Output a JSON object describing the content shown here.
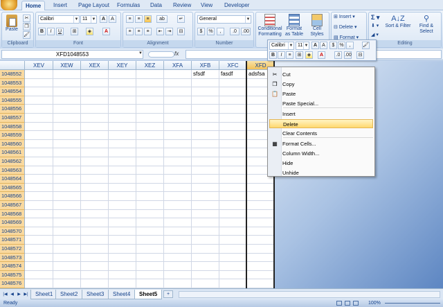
{
  "tabs": [
    "Home",
    "Insert",
    "Page Layout",
    "Formulas",
    "Data",
    "Review",
    "View",
    "Developer"
  ],
  "ribbon": {
    "clipboard": {
      "paste": "Paste",
      "label": "Clipboard"
    },
    "font": {
      "name": "Calibri",
      "size": "11",
      "label": "Font"
    },
    "alignment": {
      "label": "Alignment"
    },
    "number": {
      "format": "General",
      "label": "Number"
    },
    "styles": {
      "conditional": "Conditional Formatting",
      "format_table": "Format as Table",
      "cell_styles": "Cell Styles"
    },
    "cells": {
      "insert": "Insert",
      "delete": "Delete",
      "format": "Format"
    },
    "editing": {
      "sort": "Sort & Filter",
      "find": "Find & Select",
      "label": "Editing"
    }
  },
  "formula_bar": {
    "name_box": "XFD1048553",
    "fx": "fx",
    "value": ""
  },
  "columns": [
    "XEV",
    "XEW",
    "XEX",
    "XEY",
    "XEZ",
    "XFA",
    "XFB",
    "XFC",
    "XFD"
  ],
  "rows": [
    "1048552",
    "1048553",
    "1048554",
    "1048555",
    "1048556",
    "1048557",
    "1048558",
    "1048559",
    "1048560",
    "1048561",
    "1048562",
    "1048563",
    "1048564",
    "1048565",
    "1048566",
    "1048567",
    "1048568",
    "1048569",
    "1048570",
    "1048571",
    "1048572",
    "1048573",
    "1048574",
    "1048575",
    "1048576"
  ],
  "cells": [
    {
      "col": "XFB",
      "row": "1048552",
      "value": "sfsdf"
    },
    {
      "col": "XFC",
      "row": "1048552",
      "value": "fasdf"
    },
    {
      "col": "XFD",
      "row": "1048552",
      "value": "adsfsa"
    }
  ],
  "mini_toolbar": {
    "font": "Calibri",
    "size": "11"
  },
  "context_menu": [
    {
      "label": "Cut",
      "icon": "scissors-icon"
    },
    {
      "label": "Copy",
      "icon": "copy-icon"
    },
    {
      "label": "Paste",
      "icon": "paste-icon"
    },
    {
      "label": "Paste Special...",
      "icon": ""
    },
    {
      "label": "Insert",
      "icon": ""
    },
    {
      "label": "Delete",
      "icon": "",
      "highlighted": true
    },
    {
      "label": "Clear Contents",
      "icon": ""
    },
    {
      "label": "Format Cells...",
      "icon": "format-cells-icon"
    },
    {
      "label": "Column Width...",
      "icon": ""
    },
    {
      "label": "Hide",
      "icon": ""
    },
    {
      "label": "Unhide",
      "icon": ""
    }
  ],
  "sheets": [
    "Sheet1",
    "Sheet2",
    "Sheet3",
    "Sheet4",
    "Sheet5"
  ],
  "active_sheet": "Sheet5",
  "status": {
    "ready": "Ready",
    "zoom": "100%"
  }
}
